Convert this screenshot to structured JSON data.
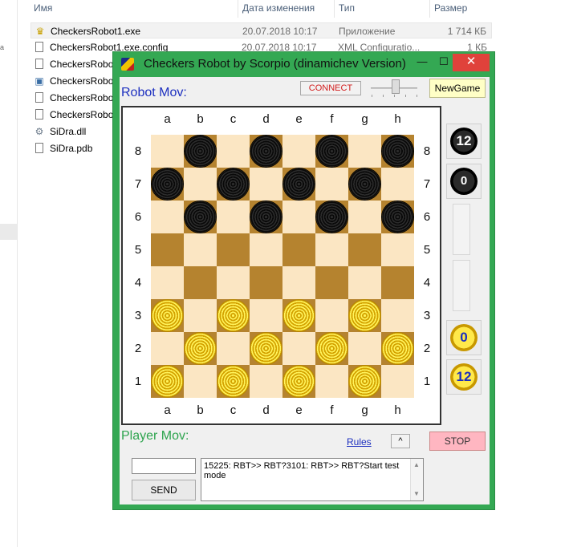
{
  "explorer": {
    "columns": {
      "name": "Имя",
      "date": "Дата изменения",
      "type": "Тип",
      "size": "Размер"
    },
    "files": [
      {
        "name": "CheckersRobot1.exe",
        "date": "20.07.2018 10:17",
        "type": "Приложение",
        "size": "1 714 КБ",
        "icon": "crown-icon"
      },
      {
        "name": "CheckersRobot1.exe.config",
        "date": "20.07.2018 10:17",
        "type": "XML Configuratio...",
        "size": "1 КБ",
        "icon": "file-icon"
      },
      {
        "name": "CheckersRobot",
        "date": "",
        "type": "",
        "size": "",
        "icon": "file-icon"
      },
      {
        "name": "CheckersRobot",
        "date": "",
        "type": "",
        "size": "",
        "icon": "app-window-icon"
      },
      {
        "name": "CheckersRobot",
        "date": "",
        "type": "",
        "size": "",
        "icon": "file-icon"
      },
      {
        "name": "CheckersRobot",
        "date": "",
        "type": "",
        "size": "",
        "icon": "file-icon"
      },
      {
        "name": "SiDra.dll",
        "date": "",
        "type": "",
        "size": "",
        "icon": "gear-file-icon"
      },
      {
        "name": "SiDra.pdb",
        "date": "",
        "type": "",
        "size": "",
        "icon": "file-icon"
      }
    ],
    "left_marker": "a"
  },
  "window": {
    "title": "Checkers Robot by Scorpio (dinamichev Version)",
    "min_glyph": "—",
    "max_glyph": "☐",
    "close_glyph": "✕"
  },
  "app": {
    "robot_label": "Robot Mov:",
    "connect_label": "CONNECT",
    "newgame_label": "NewGame",
    "player_label": "Player Mov:",
    "rules_label": "Rules",
    "updown_label": "^",
    "stop_label": "STOP",
    "send_label": "SEND",
    "input_value": "",
    "log_text": "15225: RBT>> RBT?3101: RBT>> RBT?Start test mode"
  },
  "board": {
    "files": [
      "a",
      "b",
      "c",
      "d",
      "e",
      "f",
      "g",
      "h"
    ],
    "ranks": [
      "8",
      "7",
      "6",
      "5",
      "4",
      "3",
      "2",
      "1"
    ],
    "rows": [
      "_b_b_b_b",
      "b_b_b_b_",
      "_b_b_b_b",
      "________",
      "________",
      "w_w_w_w_",
      "_w_w_w_w",
      "w_w_w_w_"
    ],
    "colors": {
      "light": "#fbe6c3",
      "dark": "#b5832f"
    }
  },
  "side_panel": {
    "black_count": "12",
    "black_king_count": "0",
    "gold_king_count": "0",
    "gold_count": "12"
  }
}
